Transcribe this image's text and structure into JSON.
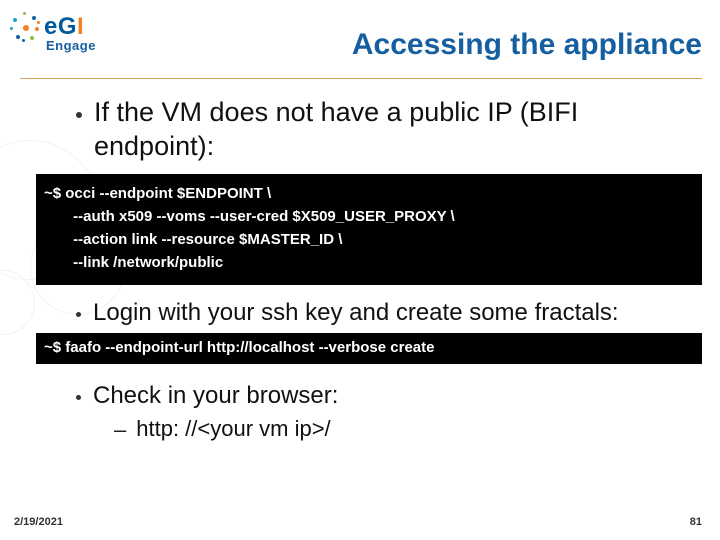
{
  "logo": {
    "name_part1": "e",
    "name_part2": "G",
    "name_part3": "I",
    "subtitle": "Engage"
  },
  "title": "Accessing the appliance",
  "bullets": {
    "b1": "If the VM does not have a public IP (BIFI endpoint):",
    "code1_l1": "~$ occi --endpoint $ENDPOINT \\",
    "code1_l2": "       --auth x509 --voms --user-cred $X509_USER_PROXY \\",
    "code1_l3": "       --action link --resource $MASTER_ID \\",
    "code1_l4": "       --link /network/public",
    "b2": "Login with your ssh key and create some fractals:",
    "code2": "~$ faafo --endpoint-url http://localhost --verbose create",
    "b3": "Check in your browser:",
    "sub1": "http: //<your vm ip>/"
  },
  "footer": {
    "date": "2/19/2021",
    "page": "81"
  }
}
